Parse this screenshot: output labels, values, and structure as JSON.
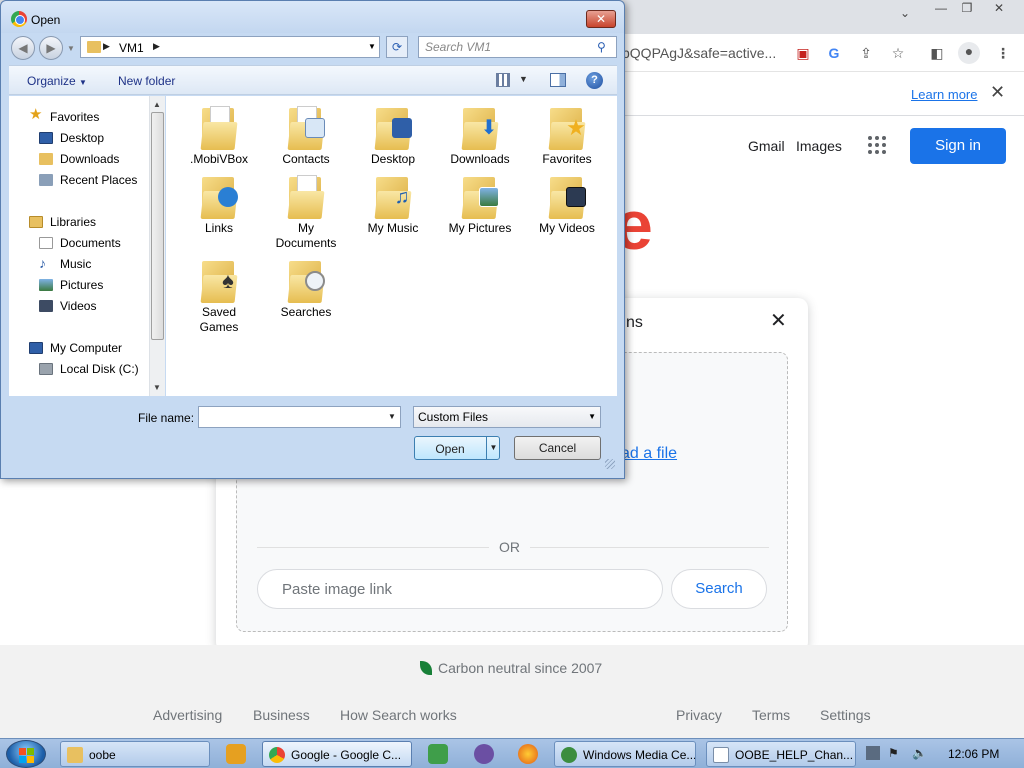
{
  "chrome": {
    "url_text": "bQQPAgJ&safe=active...",
    "learn_more": "Learn more",
    "header": {
      "gmail": "Gmail",
      "images": "Images",
      "sign_in": "Sign in"
    },
    "logo_fragment": "e",
    "card": {
      "title_fragment": "ns",
      "upload_link": "ad a file",
      "or_text": "OR",
      "image_link_placeholder": "Paste image link",
      "search_button": "Search"
    },
    "footer": {
      "carbon": "Carbon neutral since 2007",
      "links_left": [
        "Advertising",
        "Business",
        "How Search works"
      ],
      "links_right": [
        "Privacy",
        "Terms",
        "Settings"
      ]
    }
  },
  "dialog": {
    "title": "Open",
    "address_crumb": "VM1",
    "search_placeholder": "Search VM1",
    "organize": "Organize",
    "new_folder": "New folder",
    "nav": {
      "favorites": "Favorites",
      "favorites_items": [
        "Desktop",
        "Downloads",
        "Recent Places"
      ],
      "libraries": "Libraries",
      "libraries_items": [
        "Documents",
        "Music",
        "Pictures",
        "Videos"
      ],
      "computer": "My Computer",
      "computer_items": [
        "Local Disk (C:)"
      ]
    },
    "folders": [
      [
        ".MobiVBox"
      ],
      [
        "Contacts"
      ],
      [
        "Desktop"
      ],
      [
        "Downloads"
      ],
      [
        "Favorites"
      ],
      [
        "Links"
      ],
      [
        "My",
        "Documents"
      ],
      [
        "My Music"
      ],
      [
        "My Pictures"
      ],
      [
        "My Videos"
      ],
      [
        "Saved",
        "Games"
      ],
      [
        "Searches"
      ]
    ],
    "file_name_label": "File name:",
    "file_name_value": "",
    "file_type": "Custom Files",
    "open_button": "Open",
    "cancel_button": "Cancel"
  },
  "taskbar": {
    "buttons": [
      "oobe",
      "Google - Google C...",
      "Windows Media Ce...",
      "OOBE_HELP_Chan..."
    ],
    "clock": "12:06 PM"
  },
  "colors": {
    "accent": "#1a73e8",
    "dialog_frame": "#c6daf2",
    "taskbar": "#9dbbe0"
  }
}
